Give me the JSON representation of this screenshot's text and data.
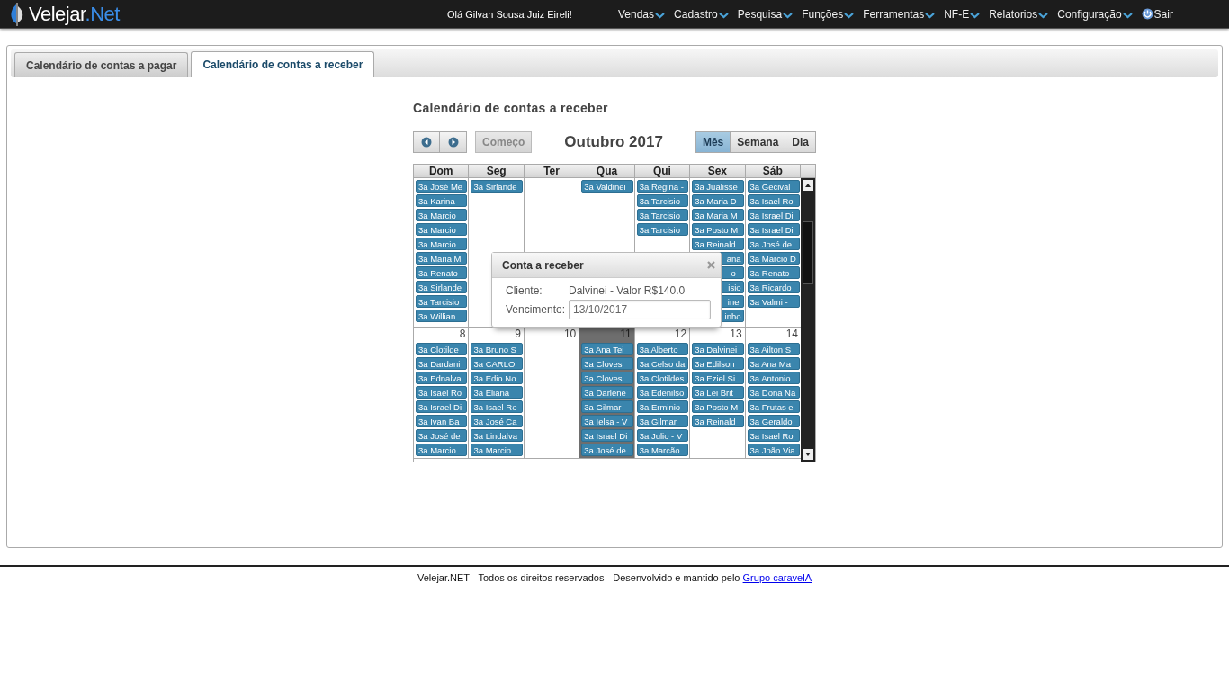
{
  "navbar": {
    "logo": {
      "name": "Velejar",
      "suffix": ".Net"
    },
    "greeting": "Olá Gilvan Sousa Juiz Eireli!",
    "menu": [
      {
        "label": "Vendas",
        "kind": "dropdown"
      },
      {
        "label": "Cadastro",
        "kind": "dropdown"
      },
      {
        "label": "Pesquisa",
        "kind": "dropdown"
      },
      {
        "label": "Funções",
        "kind": "dropdown"
      },
      {
        "label": "Ferramentas",
        "kind": "dropdown"
      },
      {
        "label": "NF-E",
        "kind": "dropdown"
      },
      {
        "label": "Relatorios",
        "kind": "dropdown"
      },
      {
        "label": "Configuração",
        "kind": "dropdown"
      },
      {
        "label": "Sair",
        "kind": "logout"
      }
    ]
  },
  "tabs": [
    {
      "label": "Calendário de contas a pagar",
      "selected": false
    },
    {
      "label": "Calendário de contas a receber",
      "selected": true
    }
  ],
  "calendar": {
    "title": "Calendário de contas a receber",
    "today_button": {
      "label": "Começo",
      "disabled": true
    },
    "month_label": "Outubro 2017",
    "views": [
      {
        "label": "Mês",
        "selected": true
      },
      {
        "label": "Semana",
        "selected": false
      },
      {
        "label": "Dia",
        "selected": false
      }
    ],
    "weekdays": [
      "Dom",
      "Seg",
      "Ter",
      "Qua",
      "Qui",
      "Sex",
      "Sáb"
    ],
    "weeks": [
      {
        "days": [
          {
            "today": false,
            "events": [
              {
                "label": "3a José Me",
                "covered": false
              },
              {
                "label": "3a Karina",
                "covered": false
              },
              {
                "label": "3a Marcio",
                "covered": false
              },
              {
                "label": "3a Marcio",
                "covered": false
              },
              {
                "label": "3a Marcio",
                "covered": false
              },
              {
                "label": "3a Maria M",
                "covered": false
              },
              {
                "label": "3a Renato",
                "covered": false
              },
              {
                "label": "3a Sirlande",
                "covered": false
              },
              {
                "label": "3a Tarcisio",
                "covered": false
              },
              {
                "label": "3a Willian",
                "covered": false
              }
            ]
          },
          {
            "today": false,
            "events": [
              {
                "label": "3a Sirlande",
                "covered": false
              }
            ]
          },
          {
            "today": false
          },
          {
            "today": false,
            "events": [
              {
                "label": "3a Valdinei",
                "covered": false
              }
            ]
          },
          {
            "today": false,
            "events": [
              {
                "label": "3a Regina -",
                "covered": false
              },
              {
                "label": "3a Tarcisio",
                "covered": false
              },
              {
                "label": "3a Tarcisio",
                "covered": false
              },
              {
                "label": "3a Tarcisio",
                "covered": false
              }
            ]
          },
          {
            "today": false,
            "events": [
              {
                "label": "3a Jualisse",
                "covered": false
              },
              {
                "label": "3a Maria D",
                "covered": false
              },
              {
                "label": "3a Maria M",
                "covered": false
              },
              {
                "label": "3a Posto M",
                "covered": false
              },
              {
                "label": "3a Reinald",
                "covered": false
              },
              {
                "label": "ana",
                "covered": true
              },
              {
                "label": "o -",
                "covered": true
              },
              {
                "label": "isio",
                "covered": true
              },
              {
                "label": "inei",
                "covered": true
              },
              {
                "label": "inho",
                "covered": true
              }
            ]
          },
          {
            "today": false,
            "events": [
              {
                "label": "3a Gecival",
                "covered": false
              },
              {
                "label": "3a Isael Ro",
                "covered": false
              },
              {
                "label": "3a Israel Di",
                "covered": false
              },
              {
                "label": "3a Israel Di",
                "covered": false
              },
              {
                "label": "3a José de",
                "covered": false
              },
              {
                "label": "3a Marcio D",
                "covered": false
              },
              {
                "label": "3a Renato",
                "covered": false
              },
              {
                "label": "3a Ricardo",
                "covered": false
              },
              {
                "label": "3a Valmi -",
                "covered": false
              }
            ]
          }
        ]
      },
      {
        "days": [
          {
            "day": "8",
            "today": false,
            "events": [
              {
                "label": "3a Clotilde",
                "covered": false
              },
              {
                "label": "3a Dardani",
                "covered": false
              },
              {
                "label": "3a Ednalva",
                "covered": false
              },
              {
                "label": "3a Isael Ro",
                "covered": false
              },
              {
                "label": "3a Israel Di",
                "covered": false
              },
              {
                "label": "3a Ivan Ba",
                "covered": false
              },
              {
                "label": "3a José de",
                "covered": false
              },
              {
                "label": "3a Marcio",
                "covered": false
              }
            ]
          },
          {
            "day": "9",
            "today": false,
            "events": [
              {
                "label": "3a Bruno S",
                "covered": false
              },
              {
                "label": "3a CARLO",
                "covered": false
              },
              {
                "label": "3a Edio No",
                "covered": false
              },
              {
                "label": "3a Eliana",
                "covered": false
              },
              {
                "label": "3a Isael Ro",
                "covered": false
              },
              {
                "label": "3a José Ca",
                "covered": false
              },
              {
                "label": "3a Lindalva",
                "covered": false
              },
              {
                "label": "3a Marcio",
                "covered": false
              }
            ]
          },
          {
            "day": "10",
            "today": false
          },
          {
            "day": "11",
            "today": true,
            "events": [
              {
                "label": "3a Ana Tei",
                "covered": false
              },
              {
                "label": "3a Cloves",
                "covered": false
              },
              {
                "label": "3a Cloves",
                "covered": false
              },
              {
                "label": "3a Darlene",
                "covered": false
              },
              {
                "label": "3a Gilmar",
                "covered": false
              },
              {
                "label": "3a Ielsa - V",
                "covered": false
              },
              {
                "label": "3a Israel Di",
                "covered": false
              },
              {
                "label": "3a José de",
                "covered": false
              }
            ]
          },
          {
            "day": "12",
            "today": false,
            "events": [
              {
                "label": "3a Alberto",
                "covered": false
              },
              {
                "label": "3a Celso da",
                "covered": false
              },
              {
                "label": "3a Clotildes",
                "covered": false
              },
              {
                "label": "3a Edenilso",
                "covered": false
              },
              {
                "label": "3a Erminio",
                "covered": false
              },
              {
                "label": "3a Gilmar",
                "covered": false
              },
              {
                "label": "3a Julio - V",
                "covered": false
              },
              {
                "label": "3a Marcão",
                "covered": false
              }
            ]
          },
          {
            "day": "13",
            "today": false,
            "events": [
              {
                "label": "3a Dalvinei",
                "covered": false
              },
              {
                "label": "3a Edilson",
                "covered": false
              },
              {
                "label": "3a Eziel Si",
                "covered": false
              },
              {
                "label": "3a Lei Brit",
                "covered": false
              },
              {
                "label": "3a Posto M",
                "covered": false
              },
              {
                "label": "3a Reinald",
                "covered": false
              }
            ]
          },
          {
            "day": "14",
            "today": false,
            "events": [
              {
                "label": "3a Ailton S",
                "covered": false
              },
              {
                "label": "3a Ana Ma",
                "covered": false
              },
              {
                "label": "3a Antonio",
                "covered": false
              },
              {
                "label": "3a Dona Na",
                "covered": false
              },
              {
                "label": "3a Frutas e",
                "covered": false
              },
              {
                "label": "3a Geraldo",
                "covered": false
              },
              {
                "label": "3a Isael Ro",
                "covered": false
              },
              {
                "label": "3a João Via",
                "covered": false
              }
            ]
          }
        ]
      }
    ]
  },
  "popup": {
    "title": "Conta a receber",
    "fields": [
      {
        "label": "Cliente:",
        "value": "Dalvinei - Valor R$140.0",
        "kind": "text"
      },
      {
        "label": "Vencimento:",
        "value": "13/10/2017",
        "kind": "input"
      }
    ]
  },
  "footer": {
    "text": "Velejar.NET - Todos os direitos reservados - Desenvolvido e mantido pelo",
    "link": "Grupo caravelA"
  }
}
